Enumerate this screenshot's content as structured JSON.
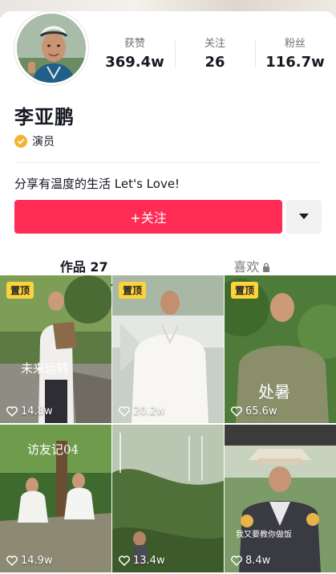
{
  "profile": {
    "name": "李亚鹏",
    "verify_label": "演员",
    "bio": "分享有温度的生活 Let's Love!"
  },
  "stats": [
    {
      "label": "获赞",
      "value": "369.4w"
    },
    {
      "label": "关注",
      "value": "26"
    },
    {
      "label": "粉丝",
      "value": "116.7w"
    }
  ],
  "actions": {
    "follow_label": "+关注",
    "more_icon": "caret-down-icon"
  },
  "tabs": [
    {
      "label": "作品 27",
      "active": true
    },
    {
      "label": "喜欢",
      "locked": true,
      "icon": "lock-icon"
    }
  ],
  "videos": [
    {
      "pinned": true,
      "pin_label": "置顶",
      "caption": "未来运转",
      "likes": "14.8w"
    },
    {
      "pinned": true,
      "pin_label": "置顶",
      "caption": "",
      "likes": "20.2w"
    },
    {
      "pinned": true,
      "pin_label": "置顶",
      "caption": "处暑",
      "likes": "65.6w"
    },
    {
      "pinned": false,
      "caption": "访友记04",
      "likes": "14.9w"
    },
    {
      "pinned": false,
      "caption": "",
      "likes": "13.4w"
    },
    {
      "pinned": false,
      "caption": "我又要教你做饭",
      "likes": "8.4w"
    }
  ],
  "colors": {
    "accent": "#fe2c55",
    "pin_badge": "#fdd33c",
    "verify_badge": "#f3b431",
    "text_primary": "#161823",
    "text_secondary": "#6f6f73"
  }
}
